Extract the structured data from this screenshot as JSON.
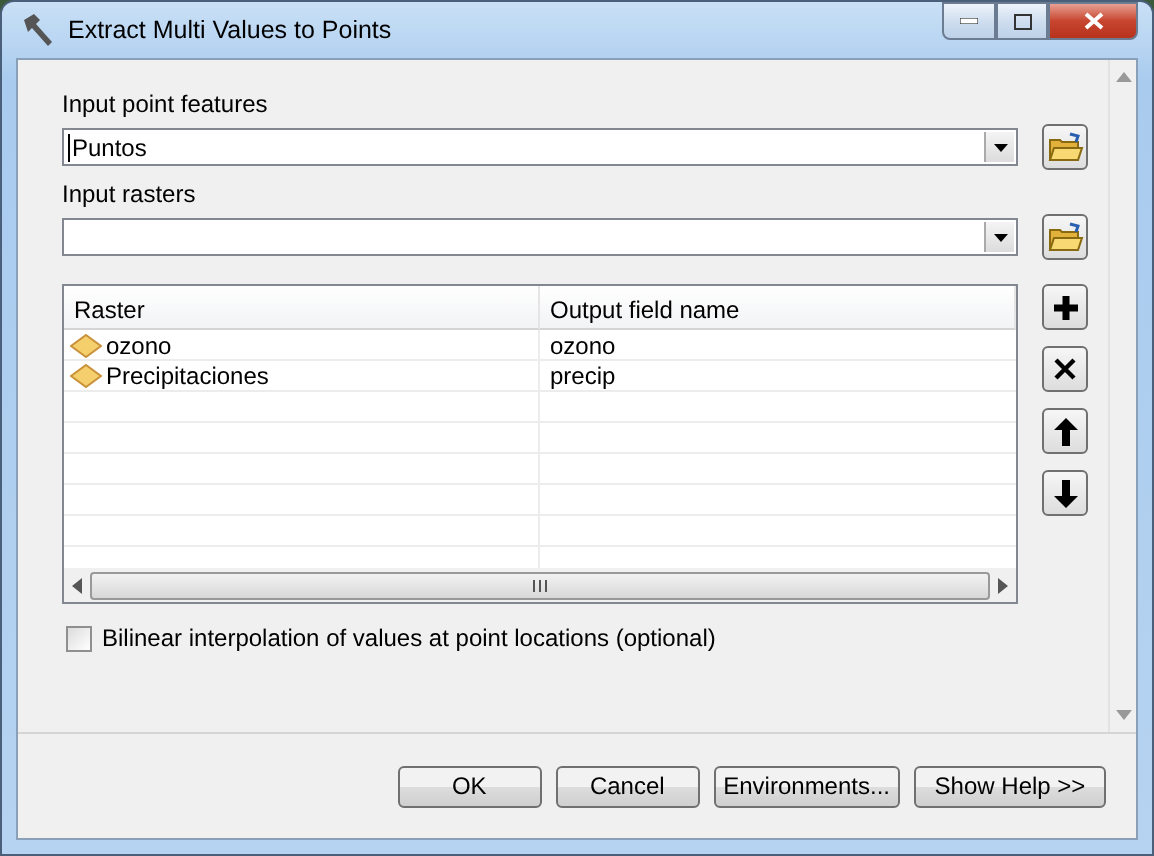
{
  "window": {
    "title": "Extract Multi Values to Points"
  },
  "point_features": {
    "label": "Input point features",
    "value": "Puntos"
  },
  "rasters": {
    "label": "Input rasters"
  },
  "table": {
    "columns": [
      "Raster",
      "Output field name"
    ],
    "rows": [
      {
        "raster": "ozono",
        "field": "ozono"
      },
      {
        "raster": "Precipitaciones",
        "field": "precip"
      }
    ]
  },
  "bilinear": {
    "label": "Bilinear interpolation of values at point locations (optional)",
    "checked": false
  },
  "buttons": [
    "OK",
    "Cancel",
    "Environments...",
    "Show Help >>"
  ]
}
